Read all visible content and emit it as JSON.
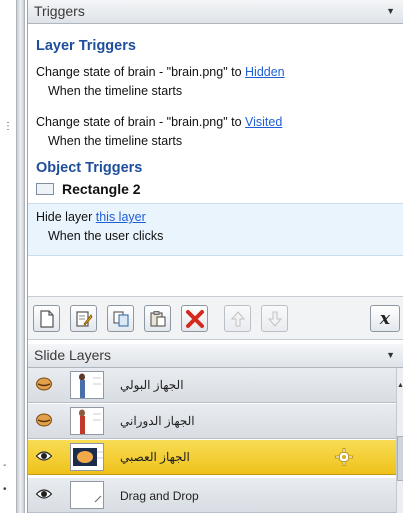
{
  "triggers_panel": {
    "header": "Triggers",
    "layer_triggers_title": "Layer Triggers",
    "items": [
      {
        "prefix": "Change state of brain - \"brain.png\" to ",
        "link": "Hidden",
        "condition": "When the timeline starts"
      },
      {
        "prefix": "Change state of brain - \"brain.png\" to ",
        "link": "Visited",
        "condition": "When the timeline starts"
      }
    ],
    "object_triggers_title": "Object Triggers",
    "object_name": "Rectangle 2",
    "object_trigger": {
      "prefix": "Hide layer ",
      "link": "this layer",
      "condition": "When the user clicks"
    }
  },
  "toolbar": {
    "buttons": [
      "new-trigger",
      "edit-trigger",
      "copy-trigger",
      "paste-trigger",
      "delete-trigger",
      "move-up",
      "move-down"
    ],
    "variables_label": "x"
  },
  "slide_layers": {
    "header": "Slide Layers",
    "layers": [
      {
        "name": "الجهاز البولي",
        "selected": false
      },
      {
        "name": "الجهاز الدوراني",
        "selected": false
      },
      {
        "name": "الجهاز العصبي",
        "selected": true
      },
      {
        "name": "Drag and Drop",
        "selected": false
      }
    ]
  },
  "colors": {
    "section_title": "#1f4e9c",
    "link": "#1f5fd6",
    "selected_layer": "#f3cc2c",
    "delete_red": "#d42a1e"
  }
}
